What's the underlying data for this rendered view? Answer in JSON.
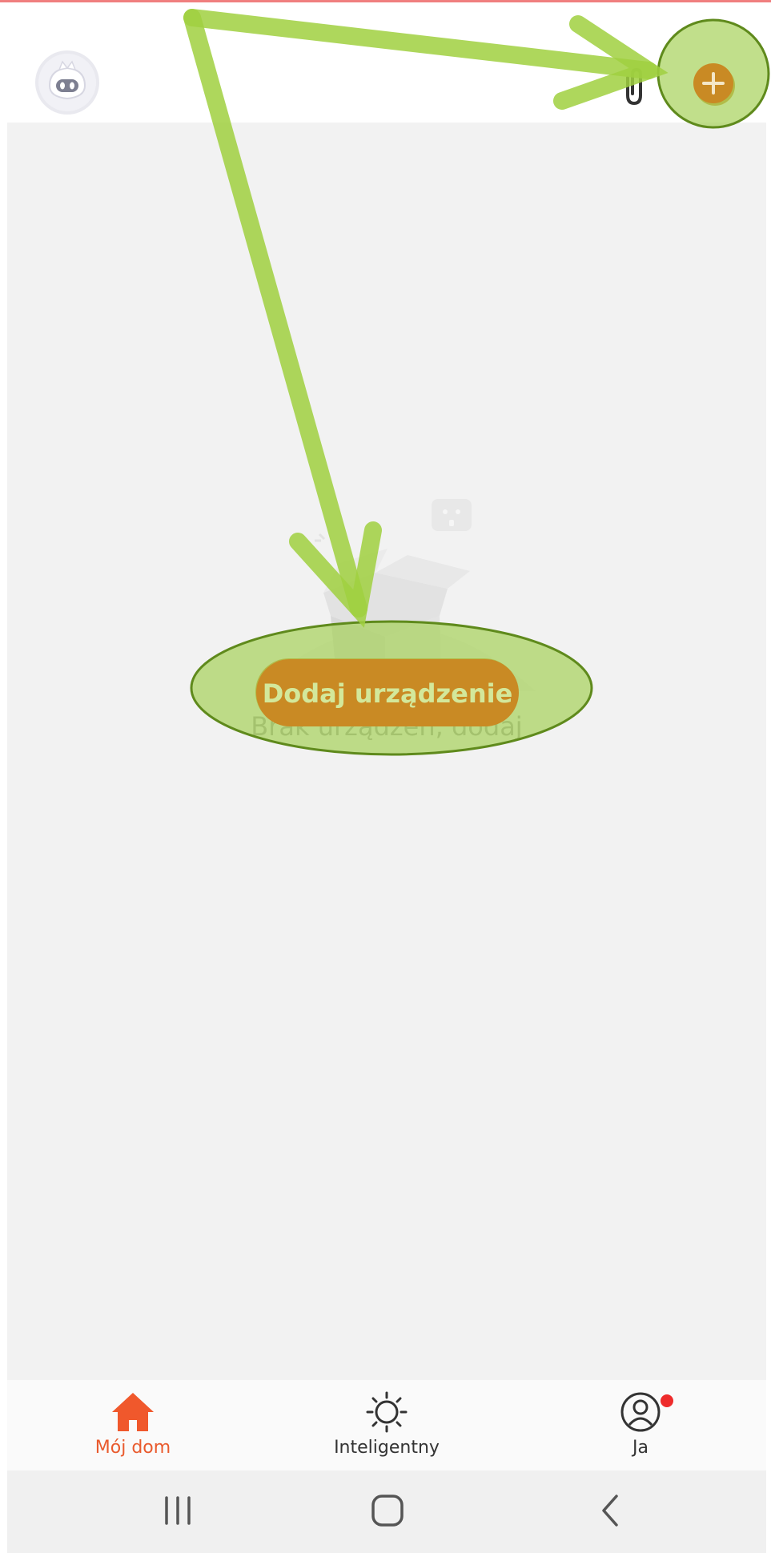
{
  "header": {
    "avatar_icon": "robot-avatar-icon",
    "attachment_icon": "paperclip-icon",
    "add_icon": "plus-icon"
  },
  "content": {
    "illustration_icon": "empty-box-illustration",
    "empty_text": "Brak urządzeń, dodaj",
    "add_device_label": "Dodaj urządzenie"
  },
  "tabs": [
    {
      "label": "Mój dom",
      "icon": "home-icon",
      "active": true
    },
    {
      "label": "Inteligentny",
      "icon": "sun-icon",
      "active": false
    },
    {
      "label": "Ja",
      "icon": "profile-icon",
      "active": false,
      "badge": true
    }
  ],
  "system_nav": {
    "recents_icon": "recents-icon",
    "home_icon": "home-button-icon",
    "back_icon": "back-icon"
  },
  "colors": {
    "accent": "#c98a24",
    "tab_active": "#e95a2d",
    "annotation": "#a6d15a",
    "annotation_stroke": "#5f8a1c",
    "badge": "#ee2b2b"
  }
}
